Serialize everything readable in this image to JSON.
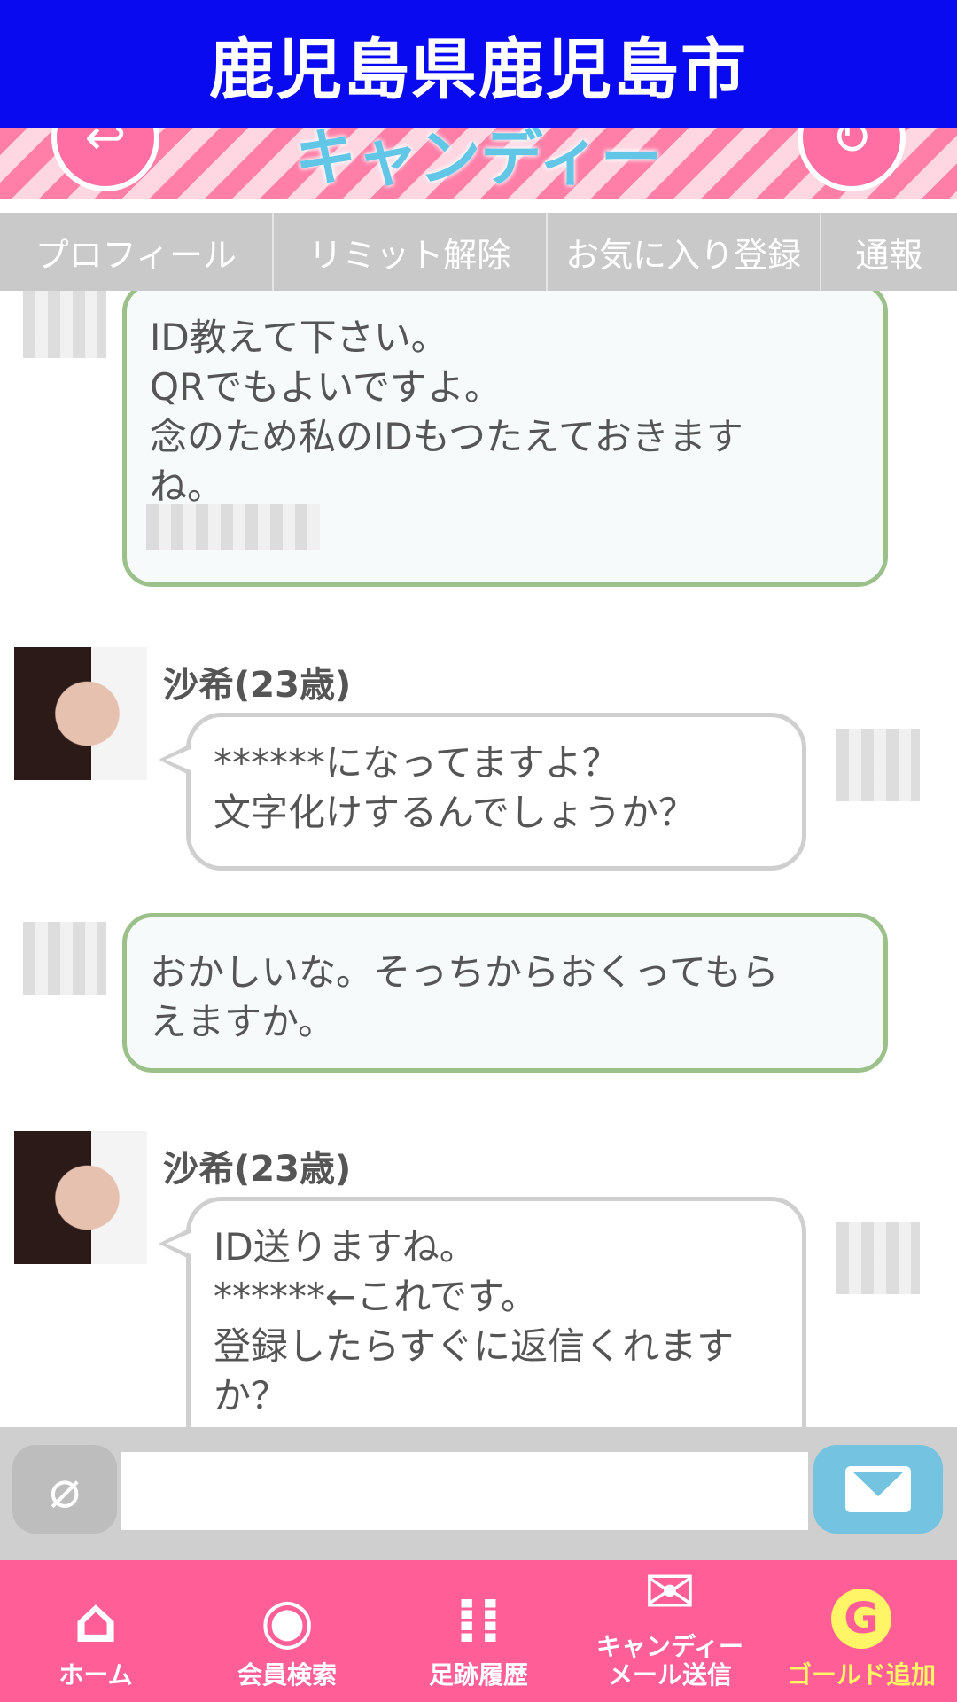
{
  "header": {
    "title": "鹿児島県鹿児島市"
  },
  "banner": {
    "logo_text": "キャンディー"
  },
  "tabs": [
    {
      "label": "プロフィール"
    },
    {
      "label": "リミット解除"
    },
    {
      "label": "お気に入り登録"
    },
    {
      "label": "通報"
    }
  ],
  "messages": [
    {
      "from": "me",
      "lines": [
        "ID教えて下さい。",
        "QRでもよいですよ。",
        "念のため私のIDもつたえておきます",
        "ね。"
      ]
    },
    {
      "from": "her",
      "name": "沙希(23歳)",
      "lines": [
        "******になってますよ？",
        "文字化けするんでしょうか？"
      ]
    },
    {
      "from": "me",
      "lines": [
        "おかしいな。そっちからおくってもら",
        "えますか。"
      ]
    },
    {
      "from": "her",
      "name": "沙希(23歳)",
      "lines": [
        "ID送りますね。",
        "******←これです。",
        "登録したらすぐに返信くれます",
        "か？"
      ]
    }
  ],
  "input": {
    "value": "",
    "placeholder": ""
  },
  "icons": {
    "attach": "paperclip-icon",
    "send": "mail-icon",
    "home": "home-icon",
    "search": "eye-icon",
    "footprints": "footprints-icon",
    "mail": "mail-icon",
    "gold": "gold-g-icon"
  },
  "nav": [
    {
      "label": "ホーム"
    },
    {
      "label": "会員検索"
    },
    {
      "label": "足跡履歴"
    },
    {
      "label": "キャンディー\nメール送信"
    },
    {
      "label": "ゴールド追加"
    }
  ],
  "colors": {
    "header_bg": "#0a0af0",
    "nav_bg": "#ff5f96",
    "my_bubble_border": "#9cc08a",
    "send_button": "#73c3e1",
    "gold_text": "#fff566"
  }
}
